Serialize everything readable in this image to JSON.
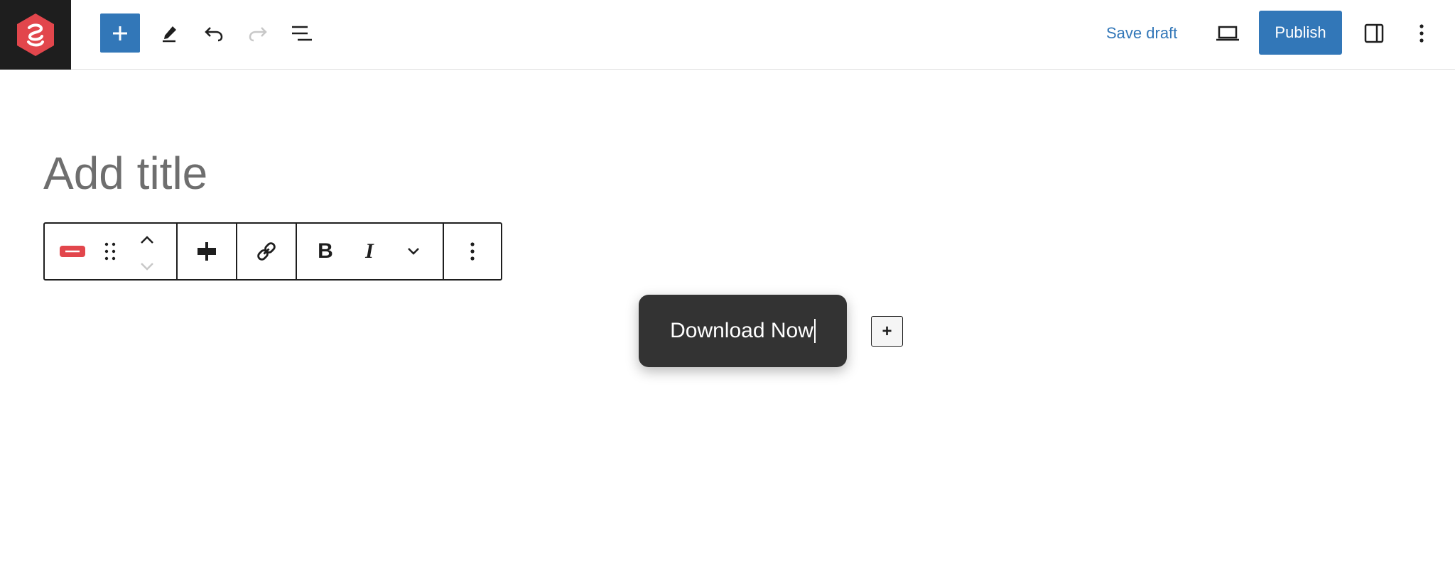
{
  "header": {
    "logo_icon": "site-logo-icon",
    "toolbar": [
      {
        "name": "inserter-toggle",
        "icon": "plus-icon"
      },
      {
        "name": "tools-button",
        "icon": "pencil-icon"
      },
      {
        "name": "undo-button",
        "icon": "undo-icon"
      },
      {
        "name": "redo-button",
        "icon": "redo-icon",
        "disabled": true
      },
      {
        "name": "document-overview-button",
        "icon": "list-view-icon"
      }
    ],
    "save_draft_label": "Save draft",
    "preview_icon": "laptop-icon",
    "publish_label": "Publish",
    "settings_icon": "sidebar-icon",
    "options_icon": "more-vertical-icon"
  },
  "editor": {
    "title_placeholder": "Add title",
    "block_toolbar": {
      "block_icon": "button-block-icon",
      "drag_icon": "drag-handle-icon",
      "move_up_icon": "chevron-up-icon",
      "move_down_icon": "chevron-down-icon",
      "align_icon": "justify-icon",
      "link_icon": "link-icon",
      "bold_label": "B",
      "italic_label": "I",
      "more_rich_text_icon": "chevron-down-icon",
      "options_icon": "more-vertical-icon"
    },
    "button_block_text": "Download Now",
    "append_label": "+"
  },
  "colors": {
    "accent": "#3277b8",
    "logo_red": "#e2464c",
    "dark": "#1e1e1e",
    "button_bg": "#333333"
  }
}
